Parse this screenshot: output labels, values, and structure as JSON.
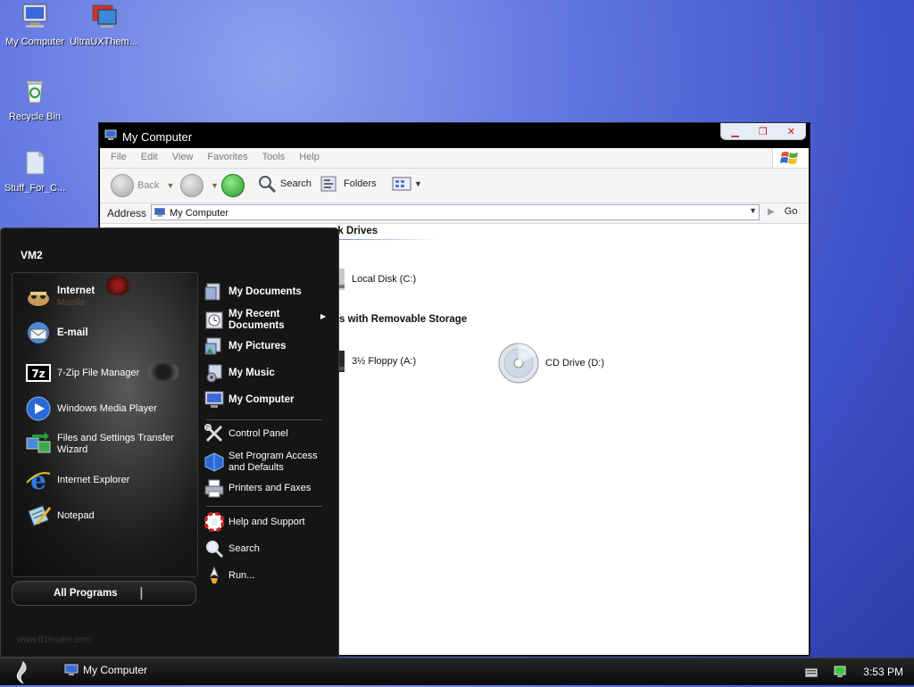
{
  "desktop": {
    "icons": [
      {
        "label": "My Computer"
      },
      {
        "label": "UltraUXThem..."
      },
      {
        "label": "Recycle Bin"
      },
      {
        "label": "Stuff_For_C..."
      }
    ]
  },
  "window": {
    "title": "My Computer",
    "menu": [
      "File",
      "Edit",
      "View",
      "Favorites",
      "Tools",
      "Help"
    ],
    "toolbar": {
      "back": "Back",
      "search": "Search",
      "folders": "Folders"
    },
    "address": {
      "label": "Address",
      "value": "My Computer",
      "go": "Go"
    },
    "sections": [
      {
        "heading": "sk Drives"
      },
      {
        "heading": "s with Removable Storage"
      }
    ],
    "drives": [
      {
        "label": "Local Disk (C:)"
      },
      {
        "label": "3½ Floppy (A:)"
      },
      {
        "label": "CD Drive (D:)"
      }
    ]
  },
  "start_menu": {
    "user": "VM2",
    "left_items": [
      {
        "label": "Internet",
        "sub": "Mozilla",
        "bold": true
      },
      {
        "label": "E-mail",
        "bold": true
      },
      {
        "label": "7-Zip File Manager"
      },
      {
        "label": "Windows Media Player"
      },
      {
        "label": "Files and Settings Transfer",
        "label2": "Wizard"
      },
      {
        "label": "Internet Explorer"
      },
      {
        "label": "Notepad"
      }
    ],
    "all_programs": "All Programs",
    "right_items": [
      {
        "label": "My Documents"
      },
      {
        "label": "My Recent",
        "label2": "Documents"
      },
      {
        "label": "My Pictures"
      },
      {
        "label": "My Music"
      },
      {
        "label": "My Computer"
      },
      {
        "label": "Control Panel"
      },
      {
        "label": "Set Program Access",
        "label2": "and Defaults"
      },
      {
        "label": "Printers and Faxes"
      },
      {
        "label": "Help and Support"
      },
      {
        "label": "Search"
      },
      {
        "label": "Run..."
      }
    ],
    "watermark": "www.tf16color.com"
  },
  "taskbar": {
    "item": "My Computer",
    "clock": "3:53 PM"
  },
  "colors": {
    "desktop": "#4a5fd6",
    "start_menu": "#151515",
    "taskbar": "#111111"
  }
}
